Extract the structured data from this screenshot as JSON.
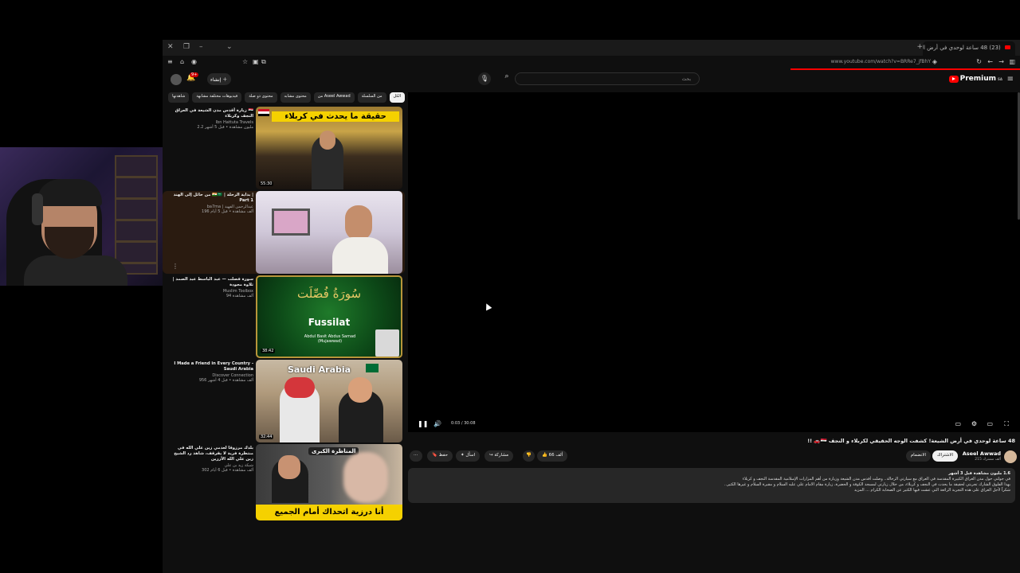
{
  "tab": {
    "title": "(23) 48 ساعة لوحدي في أرض الشيعة",
    "new_tab": "+"
  },
  "address": {
    "url": "www.youtube.com/watch?v=BRRe7_jfBhY"
  },
  "header": {
    "logo_text": "Premium",
    "logo_suffix": "SA",
    "search_placeholder": "بحث",
    "search_value": "",
    "create_label": "إنشاء",
    "notification_count": "9+"
  },
  "chips": [
    "الكل",
    "من السلسلة",
    "من Aseel Awwad",
    "محتوى مشابه",
    "محتوى ذو صلة",
    "فيديوهات مختلفة مشابهة",
    "شاهدتها"
  ],
  "recommendations": [
    {
      "title": "زيارة أقدس مدن الشيعة في العراق 🇮🇶 النجف وكربلاء",
      "channel": "Ibn Hattuta Travels",
      "stats": "2.2 مليون مشاهدة • قبل 5 أشهر",
      "duration": "55:30",
      "thumb_text": "حقيقة ما يحدث في كربلاء"
    },
    {
      "title": "من حائل إلى الهند 🇮🇳🇸🇦 | بداية الرحلة | Part 1",
      "channel": "ba7ma | عبدالرحمن الفهيد",
      "stats": "196 ألف مشاهدة • قبل 5 أيام",
      "duration": "",
      "thumb_text": ""
    },
    {
      "title": "سورة فصلت — عبد الباسط عبد الصمد | تلاوة مجودة",
      "channel": "Muslim Toolbox",
      "stats": "94 ألف مشاهدة",
      "duration": "38:42",
      "thumb_text": "Fussilat",
      "thumb_arabic": "سُورَةُ فُصِّلَت",
      "thumb_sub": "Abdul Basit Abdus Samad (Mujawwad)"
    },
    {
      "title": "I Made a Friend in Every Country - Saudi Arabia",
      "channel": "Discover Connection",
      "stats": "956 ألف مشاهدة • قبل 4 أشهر",
      "duration": "32:44",
      "thumb_text": "Saudi Arabia"
    },
    {
      "title": "بلدك مرزوقا لعدمي زين علي الله في منتظرة فرية لا يقرقف، شاهد رد الشيخ زين علي الله الأزرين",
      "channel": "شبكة زيد بن علي",
      "stats": "302 ألف مشاهدة • قبل 6 أيام",
      "duration": "",
      "thumb_text": "أنا درزية اتحداك أمام الجميع",
      "thumb_badge": "المناظرة الكبرى"
    }
  ],
  "player": {
    "time": "0:03 / 30:08"
  },
  "video": {
    "title": "48 ساعة لوحدي في أرض الشيعة! كشفت الوجه الحقيقي لكربلاء و النجف 🇮🇶🚗 !!",
    "channel": "Aseel Awwad",
    "subscribers": "215 ألف مشترك",
    "subscribe_label": "الاشتراك",
    "join_label": "الانضمام",
    "likes": "66 ألف",
    "share_label": "مشاركة",
    "ask_label": "اسأل",
    "save_label": "حفظ",
    "description_stats": "1.6 مليون مشاهدة قبل 3 أشهر",
    "description_lines": [
      "في جولتي حول مدن العراق الكبيرة المقدسة في العراق مع سيارتي الرحالة.. وصلت أقدس مدن الشيعة وزيارة من أهم المزارات الإسلامية المقدسة النجف و كربلاء",
      "بهذا الفلوق الشارك تجربتي لحقيقة ما يحدث في النجف و كربلاء، من خلال زيارتي لمسجد الكوفة و الحضرة، زيارة مقام الامام علي عليه السلام و مقبرة السلام و غيرها الكثير..",
      "شكراً لأجل العراق على هذه التجربة الرائعة التي عشت فيها الكثير عن الصحابة الكرام ... المزيد"
    ]
  }
}
